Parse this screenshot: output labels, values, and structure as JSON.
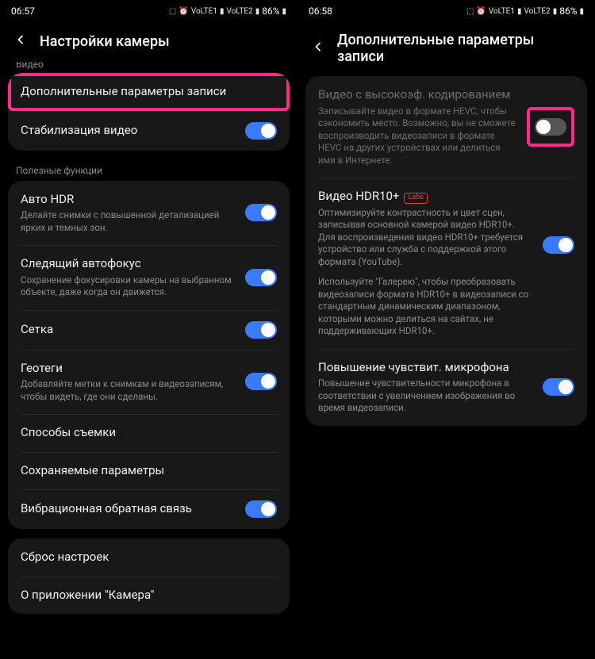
{
  "left": {
    "status": {
      "time": "06:57",
      "battery": "86%"
    },
    "title": "Настройки камеры",
    "section_video": "Видео",
    "row_adv": "Дополнительные параметры записи",
    "row_stab": "Стабилизация видео",
    "section_useful": "Полезные функции",
    "hdr": {
      "title": "Авто HDR",
      "sub": "Делайте снимки с повышенной детализацией ярких и темных зон."
    },
    "af": {
      "title": "Следящий автофокус",
      "sub": "Сохранение фокусировки камеры на выбранном объекте, даже когда он движется."
    },
    "grid": "Сетка",
    "geo": {
      "title": "Геотеги",
      "sub": "Добавляйте метки к снимкам и видеозаписям, чтобы видеть, где они сделаны."
    },
    "methods": "Способы съемки",
    "saved": "Сохраняемые параметры",
    "vibr": "Вибрационная обратная связь",
    "reset": "Сброс настроек",
    "about": "О приложении \"Камера\""
  },
  "right": {
    "status": {
      "time": "06:58",
      "battery": "86%"
    },
    "title": "Дополнительные параметры записи",
    "hevc": {
      "title": "Видео с высокоэф. кодированием",
      "sub": "Записывайте видео в формате HEVC, чтобы сэкономить место. Возможно, вы не сможете воспроизводить видеозаписи в формате HEVC на других устройствах или делиться ими в Интернете."
    },
    "hdr10": {
      "title": "Видео HDR10+",
      "labs": "Labs",
      "sub1": "Оптимизируйте контрастность и цвет сцен, записывая основной камерой видео HDR10+. Для воспроизведения видео HDR10+ требуется устройство или служба с поддержкой этого формата (YouTube).",
      "sub2": "Используйте \"Галерею\", чтобы преобразовать видеозаписи формата HDR10+ в видеозаписи со стандартным динамическим диапазоном, которыми можно делиться на сайтах, не поддерживающих HDR10+."
    },
    "mic": {
      "title": "Повышение чувствит. микрофона",
      "sub": "Повышение чувствительности микрофона в соответствии с увеличением изображения во время видеозаписи."
    }
  }
}
